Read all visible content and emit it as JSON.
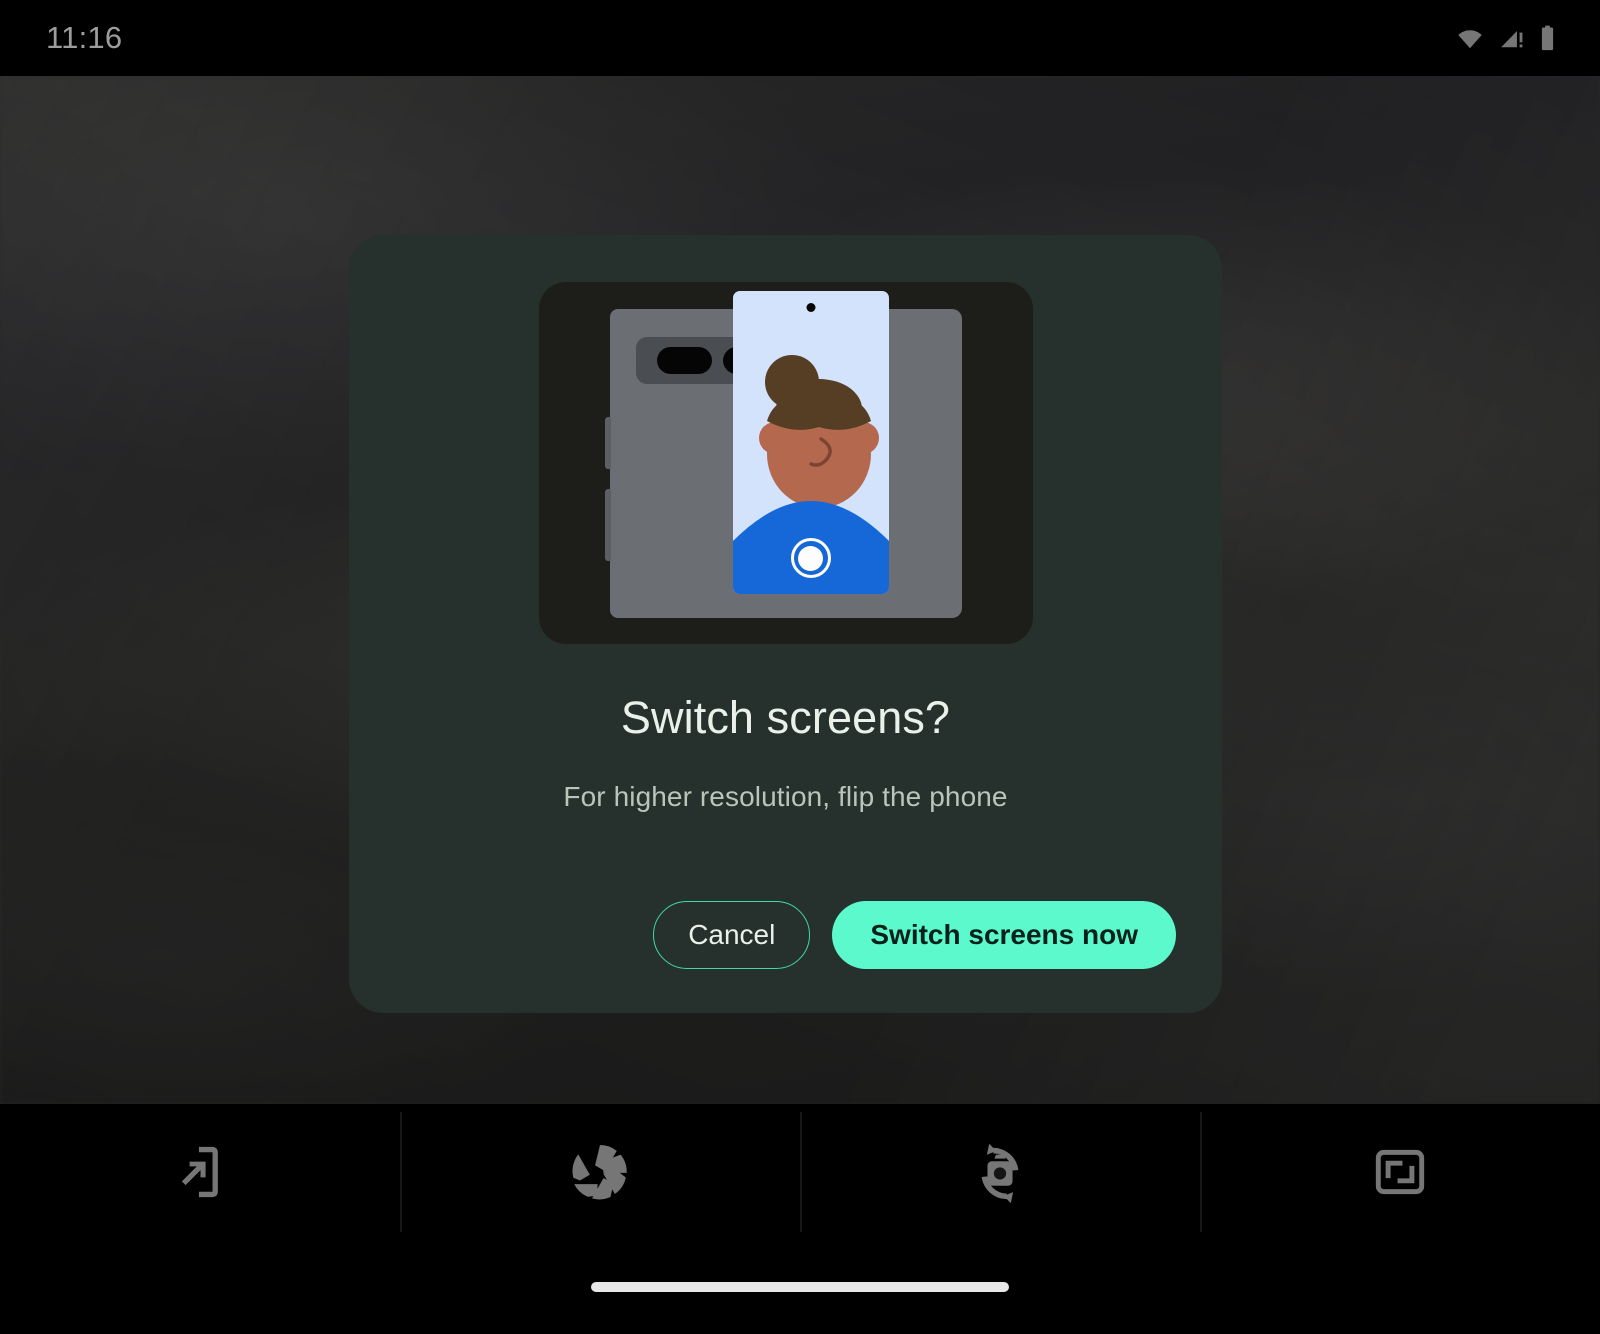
{
  "status_bar": {
    "clock": "11:16",
    "icons": [
      {
        "name": "wifi-icon",
        "label": "Wi-Fi"
      },
      {
        "name": "cellular-signal-warning-icon",
        "label": "No SIM / signal warning"
      },
      {
        "name": "battery-icon",
        "label": "Battery"
      }
    ]
  },
  "dialog": {
    "title": "Switch screens?",
    "message": "For higher resolution, flip the phone",
    "cancel_label": "Cancel",
    "confirm_label": "Switch screens now",
    "illustration": {
      "name": "foldable-phone-selfie-illustration",
      "description": "Foldable phone shown from the back with camera bar, cover screen showing a selfie preview and shutter button"
    }
  },
  "bottom_toolbar": {
    "items": [
      {
        "name": "switch-screen-icon",
        "label": "Switch screen"
      },
      {
        "name": "aperture-icon",
        "label": "Shutter"
      },
      {
        "name": "flip-camera-icon",
        "label": "Flip camera"
      },
      {
        "name": "aspect-ratio-icon",
        "label": "Aspect ratio"
      }
    ]
  },
  "nav_bar": {
    "home_indicator": "home-indicator"
  },
  "colors": {
    "dialog_background": "#26302c",
    "accent_mint": "#5cf9cc",
    "accent_outline": "#3fd9ab",
    "title_text": "#e9f1ea",
    "message_text": "#b9c4bb",
    "toolbar_icon": "#767676",
    "screen_background": "#d3e3fb",
    "shirt_blue": "#1668d8",
    "skin": "#b4694f",
    "hair": "#563e24"
  }
}
